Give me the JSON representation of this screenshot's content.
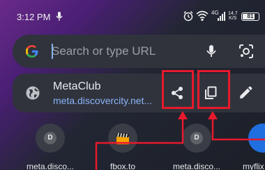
{
  "status_bar": {
    "time": "3:12 PM",
    "network": "4G",
    "speed": "14.7",
    "speed_unit": "K/S",
    "battery": "81",
    "battery_level": 0.81
  },
  "search": {
    "placeholder": "Search or type URL"
  },
  "suggestion": {
    "title": "MetaClub",
    "url": "meta.discovercity.net..."
  },
  "shortcuts": [
    {
      "letter": "D",
      "label": "meta.disco..."
    },
    {
      "letter": "",
      "label": "fbox.to"
    },
    {
      "letter": "D",
      "label": "meta.disco..."
    },
    {
      "letter": "",
      "label": "myflix"
    }
  ],
  "colors": {
    "highlight": "#e8192c",
    "link": "#8ab4f8",
    "surface": "#30333c"
  }
}
